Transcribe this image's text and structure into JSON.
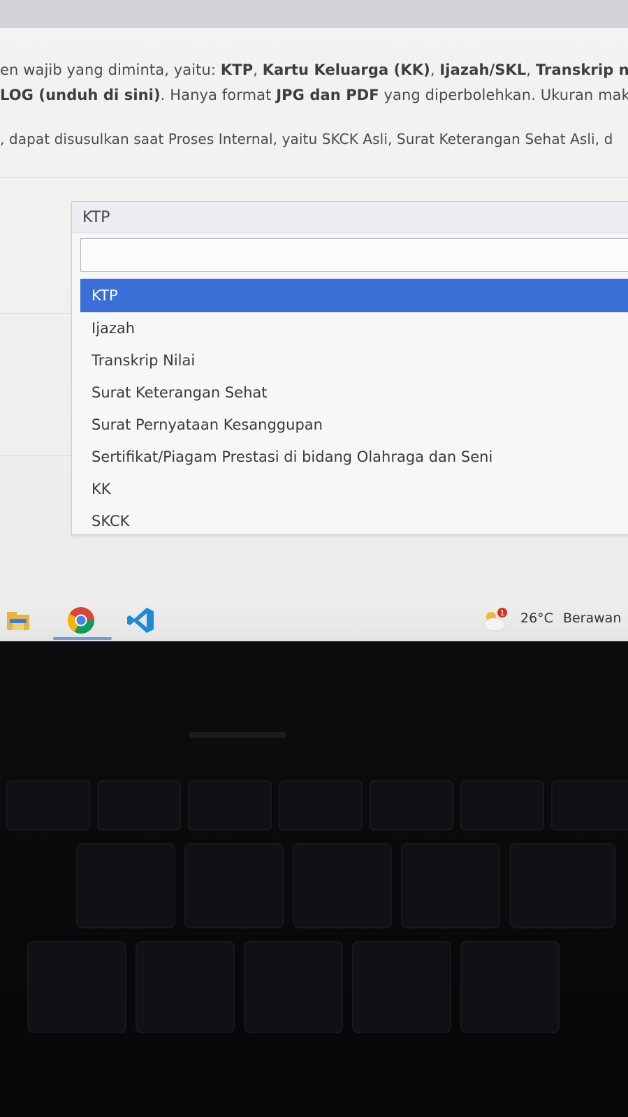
{
  "instructions": {
    "line1": [
      {
        "t": "en wajib yang diminta, yaitu: ",
        "b": false
      },
      {
        "t": "KTP",
        "b": true
      },
      {
        "t": ", ",
        "b": false
      },
      {
        "t": "Kartu Keluarga (KK)",
        "b": true
      },
      {
        "t": ", ",
        "b": false
      },
      {
        "t": "Ijazah/SKL",
        "b": true
      },
      {
        "t": ", ",
        "b": false
      },
      {
        "t": "Transkrip n",
        "b": true
      }
    ],
    "line2": [
      {
        "t": "LOG (unduh di sini)",
        "b": true
      },
      {
        "t": ". Hanya format ",
        "b": false
      },
      {
        "t": "JPG dan PDF",
        "b": true
      },
      {
        "t": " yang diperbolehkan. Ukuran maks",
        "b": false
      }
    ],
    "line3": ", dapat disusulkan saat Proses Internal, yaitu SKCK Asli, Surat Keterangan Sehat Asli, d"
  },
  "document_select": {
    "current": "KTP",
    "search_value": "",
    "options": [
      "KTP",
      "Ijazah",
      "Transkrip Nilai",
      "Surat Keterangan Sehat",
      "Surat Pernyataan Kesanggupan",
      "Sertifikat/Piagam Prestasi di bidang Olahraga dan Seni",
      "KK",
      "SKCK"
    ],
    "selected_index": 0
  },
  "taskbar": {
    "apps": [
      "file-explorer-icon",
      "chrome-icon",
      "vscode-icon"
    ],
    "weather": {
      "badge": "1",
      "temperature": "26°C",
      "condition": "Berawan"
    }
  },
  "colors": {
    "accent": "#3a6fd8",
    "badge": "#d6301e"
  }
}
